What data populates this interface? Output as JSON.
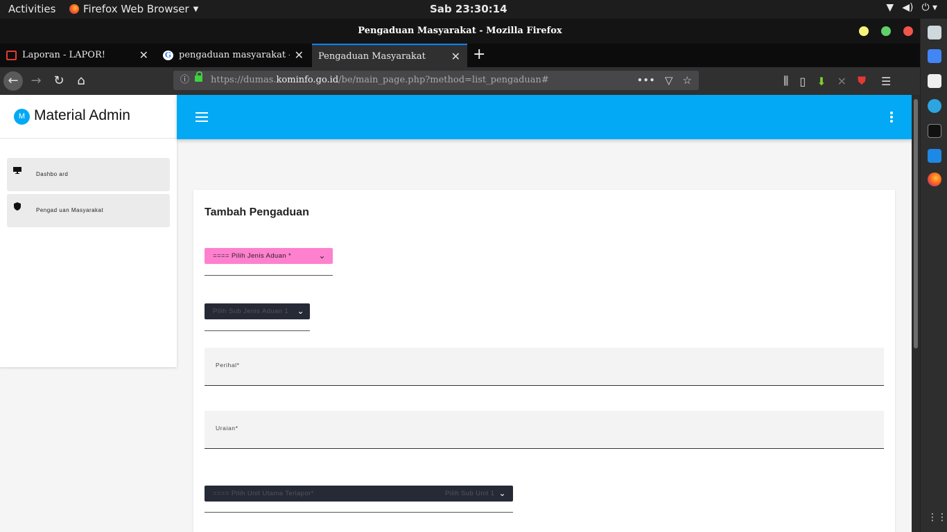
{
  "system": {
    "activities": "Activities",
    "app_name": "Firefox Web Browser",
    "clock": "Sab 23:30:14"
  },
  "window": {
    "title": "Pengaduan Masyarakat - Mozilla Firefox"
  },
  "tabs": [
    {
      "label": "Laporan - LAPOR!"
    },
    {
      "label": "pengaduan masyarakat - Penelu"
    },
    {
      "label": "Pengaduan Masyarakat"
    }
  ],
  "url": {
    "prefix": "https://dumas.",
    "domain": "kominfo.go.id",
    "path": "/be/main_page.php?method=list_pengaduan#"
  },
  "sidebar": {
    "brand_logo": "M",
    "brand_name": "Material Admin",
    "items": [
      {
        "label": "Dashbo ard",
        "icon": "monitor-icon"
      },
      {
        "label": "Pengad uan Masyarakat",
        "icon": "shield-icon"
      }
    ]
  },
  "form": {
    "title": "Tambah Pengaduan",
    "jenis_aduan": "==== Pilih Jenis Aduan *",
    "sub_jenis_aduan": "Pilih Sub Jenis Aduan 1",
    "perihal_label": "Perihal*",
    "uraian_label": "Uraian*",
    "unit_utama": "==== Pilih Unit Utama Terlapor*",
    "sub_unit": "Pilih Sub Unit 1"
  },
  "colors": {
    "appbar": "#03a9f4",
    "jenis_select": "#ff80ce",
    "dark_select": "#262a37"
  }
}
